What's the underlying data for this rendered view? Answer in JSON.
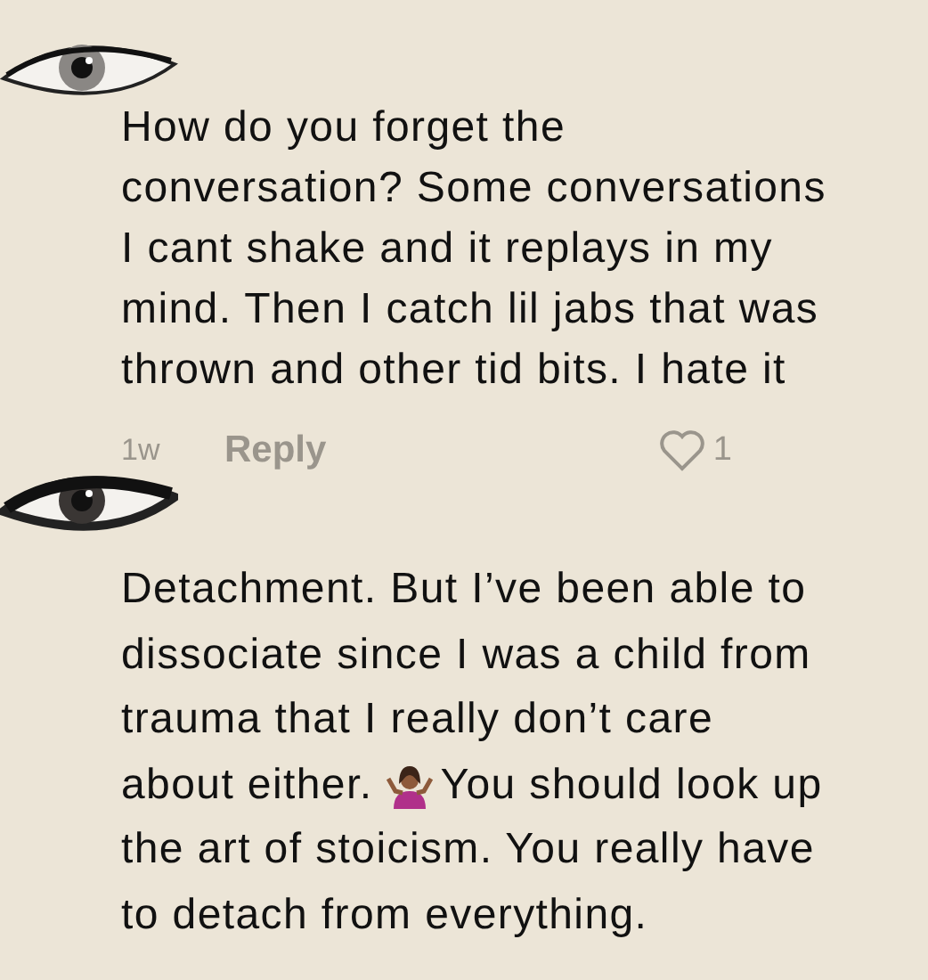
{
  "comments": [
    {
      "lines": [
        [
          "How do you forget the"
        ],
        [
          "conversation? Some conversations"
        ],
        [
          "I cant shake and it replays in my"
        ],
        [
          "mind. Then I catch lil jabs that was"
        ],
        [
          "thrown and other tid bits. I hate it"
        ]
      ],
      "time": "1w",
      "reply": "Reply",
      "likes": "1",
      "liked": false
    },
    {
      "lines": [
        [
          "Detachment. But I’ve been able to"
        ],
        [
          "dissociate since I was a child from"
        ],
        [
          "trauma that I really don’t care"
        ],
        [
          "about either.",
          "You should look up"
        ],
        [
          "the art of stoicism. You really have"
        ],
        [
          "to detach from everything."
        ]
      ]
    }
  ]
}
